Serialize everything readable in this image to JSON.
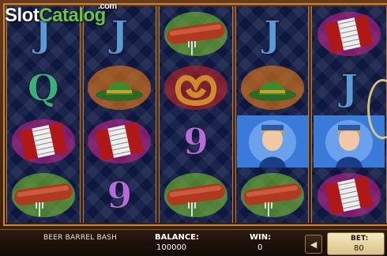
{
  "logo": {
    "part1": "Slot",
    "part2": "Catalog",
    "suffix": ".com"
  },
  "reels": [
    [
      "J",
      "Q",
      "accordion",
      "sausage"
    ],
    [
      "J",
      "hat",
      "accordion",
      "9"
    ],
    [
      "sausage",
      "pretzel",
      "9",
      "sausage"
    ],
    [
      "J",
      "hat",
      "girl",
      "sausage"
    ],
    [
      "accordion",
      "J",
      "girl",
      "accordion"
    ]
  ],
  "footer": {
    "game_name": "BEER BARREL BASH",
    "balance_label": "BALANCE:",
    "balance_value": "100000",
    "win_label": "WIN:",
    "win_value": "0",
    "bet_label": "BET:",
    "bet_value": "80",
    "decrease_icon": "chevron-left-icon"
  },
  "colors": {
    "J": "#5a9ad8",
    "Q": "#3ab07a",
    "9": "#b66cd8",
    "frame": "#c08a3a",
    "bet_bg": "#f0e2b2"
  }
}
